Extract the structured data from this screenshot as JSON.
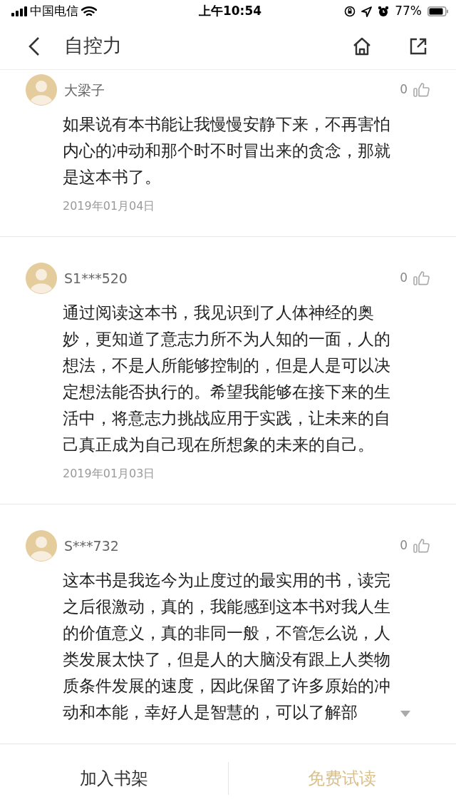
{
  "status_bar": {
    "carrier": "中国电信",
    "time": "上午10:54",
    "battery": "77%"
  },
  "header": {
    "title": "自控力"
  },
  "comments": [
    {
      "user": "大梁子",
      "likes": "0",
      "text": "如果说有本书能让我慢慢安静下来，不再害怕内心的冲动和那个时不时冒出来的贪念，那就是这本书了。",
      "date": "2019年01月04日",
      "truncated": false
    },
    {
      "user": "S1***520",
      "likes": "0",
      "text": "通过阅读这本书，我见识到了人体神经的奥妙，更知道了意志力所不为人知的一面，人的想法，不是人所能够控制的，但是人是可以决定想法能否执行的。希望我能够在接下来的生活中，将意志力挑战应用于实践，让未来的自己真正成为自己现在所想象的未来的自己。",
      "date": "2019年01月03日",
      "truncated": false
    },
    {
      "user": "S***732",
      "likes": "0",
      "text": "这本书是我迄今为止度过的最实用的书，读完之后很激动，真的，我能感到这本书对我人生的价值意义，真的非同一般，不管怎么说，人类发展太快了，但是人的大脑没有跟上人类物质条件发展的速度，因此保留了许多原始的冲动和本能，幸好人是智慧的，可以了解部",
      "truncated": true
    }
  ],
  "bottom_bar": {
    "buttons": [
      "加入书架",
      "免费试读"
    ]
  }
}
